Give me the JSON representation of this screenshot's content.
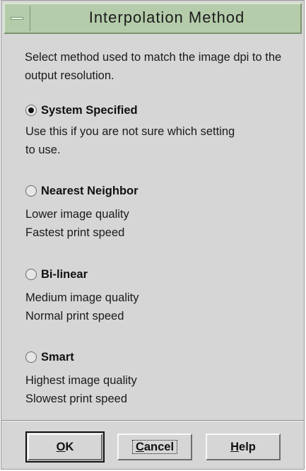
{
  "dialog": {
    "title": "Interpolation Method",
    "intro": "Select method used to match the image dpi to the output resolution."
  },
  "options": [
    {
      "label": "System Specified",
      "checked": true,
      "desc": [
        "Use this if you are not sure which setting",
        "to use."
      ]
    },
    {
      "label": "Nearest Neighbor",
      "checked": false,
      "desc": [
        "Lower image quality",
        "Fastest print speed"
      ]
    },
    {
      "label": "Bi-linear",
      "checked": false,
      "desc": [
        "Medium image quality",
        "Normal print speed"
      ]
    },
    {
      "label": "Smart",
      "checked": false,
      "desc": [
        "Highest image quality",
        "Slowest print speed"
      ]
    }
  ],
  "buttons": {
    "ok": {
      "mnemonic": "O",
      "rest": "K"
    },
    "cancel": {
      "mnemonic": "C",
      "rest": "ancel"
    },
    "help": {
      "mnemonic": "H",
      "rest": "elp"
    }
  },
  "colors": {
    "titlebar": "#b4ccaa",
    "window": "#d6d6d6"
  }
}
